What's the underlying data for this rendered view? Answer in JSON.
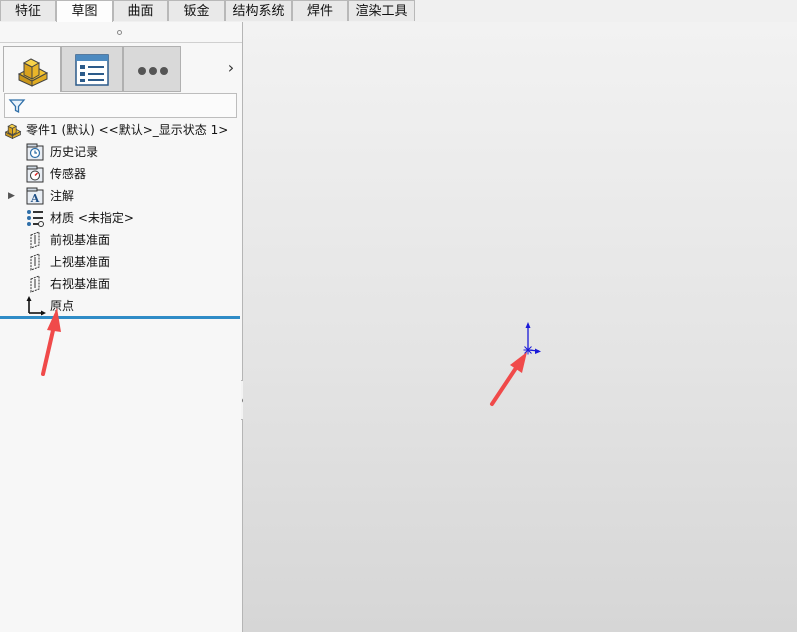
{
  "tabs": [
    {
      "label": "特征",
      "active": false
    },
    {
      "label": "草图",
      "active": true
    },
    {
      "label": "曲面",
      "active": false
    },
    {
      "label": "钣金",
      "active": false
    },
    {
      "label": "结构系统",
      "active": false
    },
    {
      "label": "焊件",
      "active": false
    },
    {
      "label": "渲染工具",
      "active": false
    }
  ],
  "panel": {
    "tabs": [
      {
        "name": "featuremanager-tab",
        "icon": "part-icon",
        "active": true
      },
      {
        "name": "propertymanager-tab",
        "icon": "property-list-icon",
        "active": false
      },
      {
        "name": "more-tab",
        "icon": "more-dots-icon",
        "active": false
      }
    ],
    "more_chevron": "›",
    "filter_icon": "filter-icon"
  },
  "tree": {
    "root": "零件1 (默认) <<默认>_显示状态 1>",
    "items": [
      {
        "label": "历史记录",
        "icon": "history-icon",
        "expandable": false
      },
      {
        "label": "传感器",
        "icon": "sensor-icon",
        "expandable": false
      },
      {
        "label": "注解",
        "icon": "annotation-icon",
        "expandable": true
      },
      {
        "label": "材质 <未指定>",
        "icon": "material-icon",
        "expandable": false
      },
      {
        "label": "前视基准面",
        "icon": "plane-icon",
        "expandable": false
      },
      {
        "label": "上视基准面",
        "icon": "plane-icon",
        "expandable": false
      },
      {
        "label": "右视基准面",
        "icon": "plane-icon",
        "expandable": false
      },
      {
        "label": "原点",
        "icon": "origin-icon",
        "expandable": false
      }
    ]
  },
  "colors": {
    "accent_blue": "#2f8cc7",
    "annotation_arrow": "#f04a4a",
    "origin_blue": "#1a1ad8"
  }
}
